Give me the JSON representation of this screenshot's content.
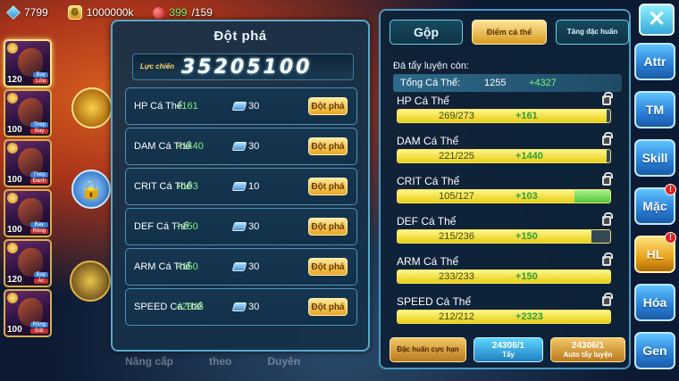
{
  "topbar": {
    "gems": "7799",
    "coins": "1000000k",
    "stamina": "399",
    "stamina_max": "/159"
  },
  "pets": [
    {
      "level": "120",
      "tag1": "Bay",
      "tag2": "Lửa"
    },
    {
      "level": "100",
      "tag1": "Thép",
      "tag2": "Bay"
    },
    {
      "level": "100",
      "tag1": "Thép",
      "tag2": "Đánh"
    },
    {
      "level": "100",
      "tag1": "Bay",
      "tag2": "Rồng"
    },
    {
      "level": "120",
      "tag1": "Bay",
      "tag2": "Ác"
    },
    {
      "level": "100",
      "tag1": "Rồng",
      "tag2": "Đất"
    }
  ],
  "bottom_tabs": [
    "Nâng cấp",
    "theo",
    "Duyên"
  ],
  "dotpha": {
    "title": "Đột phá",
    "power_label": "Lực chiến",
    "power_value": "35205100",
    "button_label": "Đột phá",
    "rows": [
      {
        "name": "HP Cá Thể",
        "bonus": "+161",
        "cost": "30"
      },
      {
        "name": "DAM Cá Thể",
        "bonus": "+1440",
        "cost": "30"
      },
      {
        "name": "CRIT Cá Thể",
        "bonus": "+103",
        "cost": "10"
      },
      {
        "name": "DEF Cá Thể",
        "bonus": "+150",
        "cost": "30"
      },
      {
        "name": "ARM Cá Thể",
        "bonus": "+150",
        "cost": "30"
      },
      {
        "name": "SPEED Cá Thể",
        "bonus": "+2323",
        "cost": "30"
      }
    ]
  },
  "cathe": {
    "tab_merge": "Gộp",
    "tab_points": "Điểm cá thể",
    "tab_special": "Tăng đặc huấn",
    "remain_label": "Đá tẩy luyện còn:",
    "total_label": "Tổng Cá Thể:",
    "total_value": "1255",
    "total_bonus": "+4327",
    "stats": [
      {
        "name": "HP Cá Thể",
        "current": "269/273",
        "bonus": "+161",
        "ratio": 0.985,
        "bonus_ratio": 0
      },
      {
        "name": "DAM Cá Thể",
        "current": "221/225",
        "bonus": "+1440",
        "ratio": 0.982,
        "bonus_ratio": 0
      },
      {
        "name": "CRIT Cá Thể",
        "current": "105/127",
        "bonus": "+103",
        "ratio": 0.83,
        "bonus_ratio": 0.17
      },
      {
        "name": "DEF Cá Thể",
        "current": "215/236",
        "bonus": "+150",
        "ratio": 0.91,
        "bonus_ratio": 0
      },
      {
        "name": "ARM Cá Thể",
        "current": "233/233",
        "bonus": "+150",
        "ratio": 1.0,
        "bonus_ratio": 0
      },
      {
        "name": "SPEED Cá Thể",
        "current": "212/212",
        "bonus": "+2323",
        "ratio": 1.0,
        "bonus_ratio": 0
      }
    ],
    "btn_special": "Đặc huấn cực hạn",
    "btn_wash_count": "24306/1",
    "btn_wash": "Tẩy",
    "btn_auto_count": "24306/1",
    "btn_auto": "Auto tẩy luyện"
  },
  "right_menu": [
    {
      "label": "Attr",
      "style": "blue",
      "badge": ""
    },
    {
      "label": "TM",
      "style": "blue",
      "badge": ""
    },
    {
      "label": "Skill",
      "style": "blue",
      "badge": ""
    },
    {
      "label": "Mặc",
      "style": "blue",
      "badge": "!"
    },
    {
      "label": "HL",
      "style": "gold",
      "badge": "!"
    },
    {
      "label": "Hóa",
      "style": "blue",
      "badge": ""
    },
    {
      "label": "Gen",
      "style": "blue",
      "badge": ""
    }
  ],
  "close_label": "✕"
}
